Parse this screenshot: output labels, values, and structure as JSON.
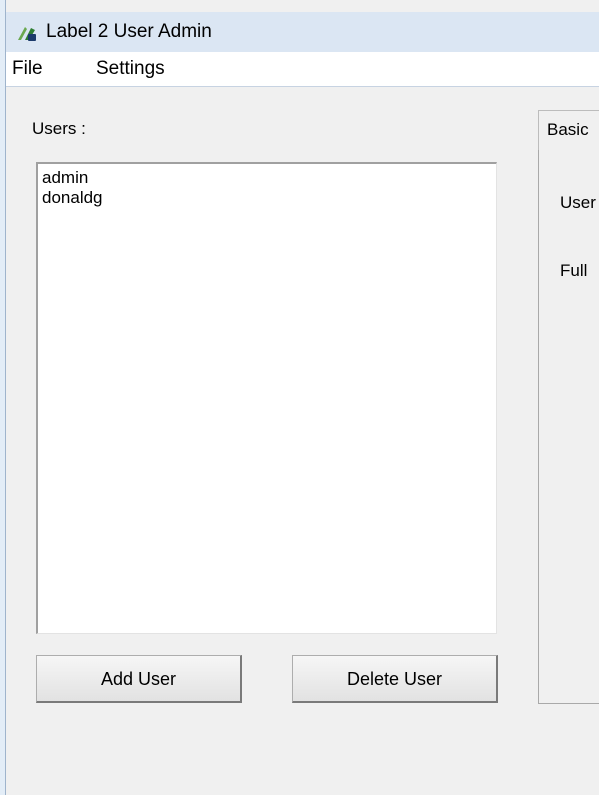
{
  "window": {
    "title": "Label 2 User Admin",
    "icon": "app-icon"
  },
  "menu": {
    "file": "File",
    "settings": "Settings"
  },
  "users_panel": {
    "label": "Users :",
    "items": [
      "admin",
      "donaldg"
    ],
    "add_button": "Add User",
    "delete_button": "Delete User"
  },
  "details_panel": {
    "tab_label": "Basic",
    "fields": {
      "username_label": "User",
      "fullname_label": "Full"
    }
  },
  "colors": {
    "titlebar": "#dbe6f3",
    "window_bg": "#f0f0f0",
    "menu_bg": "#ffffff"
  }
}
